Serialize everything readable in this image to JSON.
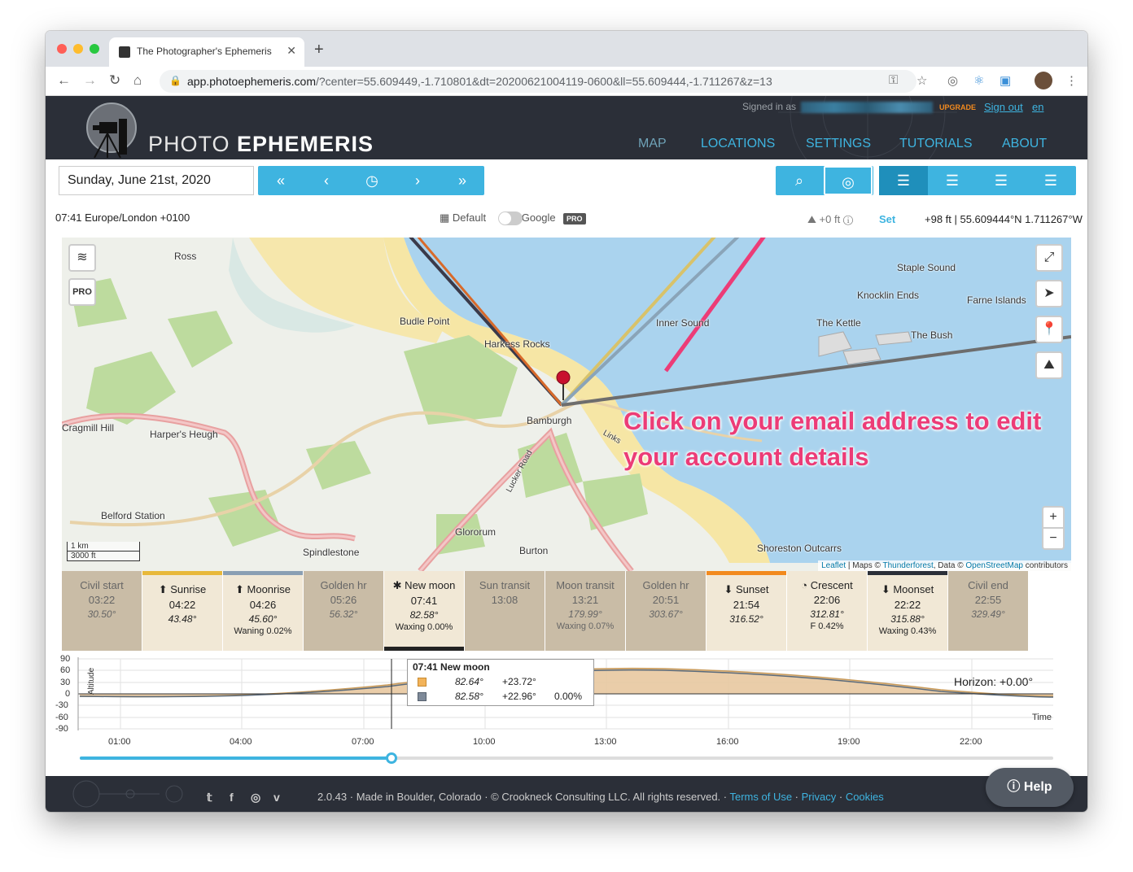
{
  "browser": {
    "tab_title": "The Photographer's Ephemeris",
    "url_host": "app.photoephemeris.com",
    "url_path": "/?center=55.609449,-1.710801&dt=20200621004119-0600&ll=55.609444,-1.711267&z=13"
  },
  "header": {
    "logo_light": "PHOTO ",
    "logo_bold": "EPHEMERIS",
    "signed_in_label": "Signed in as",
    "upgrade": "UPGRADE",
    "sign_out": "Sign out",
    "lang": "en",
    "nav": [
      "MAP",
      "LOCATIONS",
      "SETTINGS",
      "TUTORIALS",
      "ABOUT"
    ]
  },
  "controls": {
    "date": "Sunday, June 21st, 2020",
    "timezone": "07:41 Europe/London +0100",
    "map_default": "Default",
    "map_google": "Google",
    "pro": "PRO",
    "elevation": "+0 ft",
    "set": "Set",
    "coords": "+98 ft | 55.609444°N 1.711267°W"
  },
  "map": {
    "labels": [
      "Ross",
      "Budle Point",
      "Harkess Rocks",
      "Inner Sound",
      "Staple Sound",
      "Knocklin Ends",
      "Farne Islands",
      "The Kettle",
      "The Bush",
      "Bamburgh",
      "Cragmill Hill",
      "Harper's Heugh",
      "Belford Station",
      "Spindlestone",
      "Glororum",
      "Burton",
      "Shoreston Outcarrs",
      "Lucker Road",
      "Links"
    ],
    "scale_km": "1 km",
    "scale_ft": "3000 ft",
    "attribution": {
      "leaflet": "Leaflet",
      "maps": " | Maps © ",
      "thunderforest": "Thunderforest",
      "data": ", Data © ",
      "osm": "OpenStreetMap",
      "contrib": " contributors"
    },
    "pro_btn": "PRO",
    "zoom_in": "+",
    "zoom_out": "−",
    "callout_line1": "Click on your email address to edit",
    "callout_line2": "your account details"
  },
  "events": [
    {
      "label": "Civil start",
      "time": "03:22",
      "az": "30.50°",
      "extra": ""
    },
    {
      "label": "⬆ Sunrise",
      "time": "04:22",
      "az": "43.48°",
      "extra": ""
    },
    {
      "label": "⬆ Moonrise",
      "time": "04:26",
      "az": "45.60°",
      "extra": "Waning 0.02%"
    },
    {
      "label": "Golden hr",
      "time": "05:26",
      "az": "56.32°",
      "extra": ""
    },
    {
      "label": "✱ New moon",
      "time": "07:41",
      "az": "82.58°",
      "extra": "Waxing 0.00%"
    },
    {
      "label": "Sun transit",
      "time": "13:08",
      "az": "",
      "extra": ""
    },
    {
      "label": "Moon transit",
      "time": "13:21",
      "az": "179.99°",
      "extra": "Waxing 0.07%"
    },
    {
      "label": "Golden hr",
      "time": "20:51",
      "az": "303.67°",
      "extra": ""
    },
    {
      "label": "⬇ Sunset",
      "time": "21:54",
      "az": "316.52°",
      "extra": ""
    },
    {
      "label": "◔ Crescent",
      "time": "22:06",
      "az": "312.81°",
      "extra": "F 0.42%"
    },
    {
      "label": "⬇ Moonset",
      "time": "22:22",
      "az": "315.88°",
      "extra": "Waxing 0.43%"
    },
    {
      "label": "Civil end",
      "time": "22:55",
      "az": "329.49°",
      "extra": ""
    }
  ],
  "chart": {
    "y_ticks": [
      "90",
      "60",
      "30",
      "0",
      "-30",
      "-60",
      "-90"
    ],
    "x_ticks": [
      "01:00",
      "04:00",
      "07:00",
      "10:00",
      "13:00",
      "16:00",
      "19:00",
      "22:00"
    ],
    "ylabel": "Altitude",
    "xlabel": "Time",
    "horizon": "Horizon: +0.00°",
    "tooltip_title": "07:41 New moon",
    "tooltip_sun_alt": "82.64°",
    "tooltip_sun_el": "+23.72°",
    "tooltip_moon_alt": "82.58°",
    "tooltip_moon_el": "+22.96°",
    "tooltip_moon_phase": "0.00%",
    "time_progress": 0.32
  },
  "footer": {
    "text": "2.0.43 · Made in Boulder, Colorado · © Crookneck Consulting LLC. All rights reserved. · ",
    "terms": "Terms of Use",
    "sep": " · ",
    "privacy": "Privacy",
    "cookies": "Cookies",
    "help": "Help"
  },
  "colors": {
    "accent": "#3eb4e0",
    "header_bg": "#2b2f38",
    "callout": "#ec3c77",
    "water": "#aad3ee",
    "sand": "#f6e6a5",
    "wood": "#bddb9e"
  }
}
